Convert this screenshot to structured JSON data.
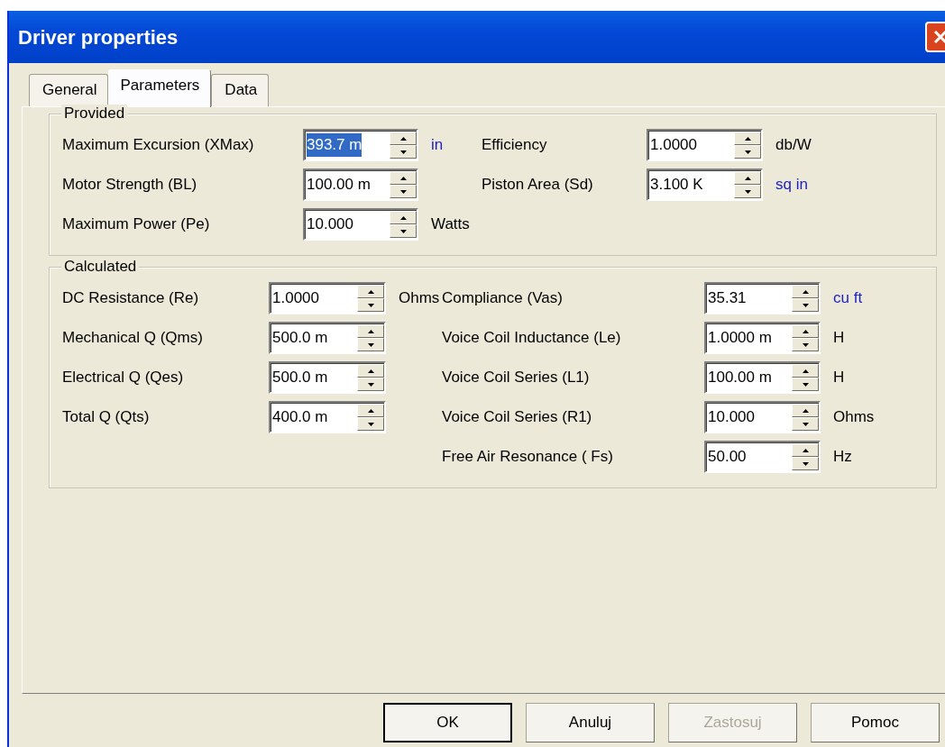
{
  "window": {
    "title": "Driver properties"
  },
  "tabs": [
    {
      "label": "General",
      "selected": false
    },
    {
      "label": "Parameters",
      "selected": true
    },
    {
      "label": "Data",
      "selected": false
    }
  ],
  "groups": [
    {
      "title": "Provided",
      "columns": [
        [
          {
            "label": "Maximum Excursion (XMax)",
            "value": "393.7 m",
            "text_selected": true,
            "unit": "in",
            "unit_link": true
          },
          {
            "label": "Motor Strength (BL)",
            "value": "100.00 m",
            "text_selected": false
          },
          {
            "label": "Maximum Power (Pe)",
            "value": "10.000",
            "text_selected": false,
            "unit": "Watts",
            "unit_link": false
          }
        ],
        [
          {
            "label": "Efficiency",
            "value": "1.0000",
            "text_selected": false,
            "unit": "db/W",
            "unit_link": false
          },
          {
            "label": "Piston Area (Sd)",
            "value": "3.100 K",
            "text_selected": false,
            "unit": "sq in",
            "unit_link": true
          }
        ]
      ]
    },
    {
      "title": "Calculated",
      "columns": [
        [
          {
            "label": "DC Resistance (Re)",
            "value": "1.0000",
            "text_selected": false,
            "unit": "Ohms",
            "unit_link": false
          },
          {
            "label": "Mechanical Q (Qms)",
            "value": "500.0 m",
            "text_selected": false
          },
          {
            "label": "Electrical Q (Qes)",
            "value": "500.0 m",
            "text_selected": false
          },
          {
            "label": "Total Q (Qts)",
            "value": "400.0 m",
            "text_selected": false
          }
        ],
        [
          {
            "label": "Compliance (Vas)",
            "value": "35.31",
            "text_selected": false,
            "unit": "cu ft",
            "unit_link": true
          },
          {
            "label": "Voice Coil Inductance (Le)",
            "value": "1.0000 m",
            "text_selected": false,
            "unit": "H",
            "unit_link": false
          },
          {
            "label": "Voice Coil Series (L1)",
            "value": "100.00 m",
            "text_selected": false,
            "unit": "H",
            "unit_link": false
          },
          {
            "label": "Voice Coil Series (R1)",
            "value": "10.000",
            "text_selected": false,
            "unit": "Ohms",
            "unit_link": false
          },
          {
            "label": "Free Air Resonance ( Fs)",
            "value": "50.00",
            "text_selected": false,
            "unit": "Hz",
            "unit_link": false
          }
        ]
      ]
    }
  ],
  "buttons": [
    {
      "label": "OK",
      "default": true,
      "disabled": false
    },
    {
      "label": "Anuluj",
      "default": false,
      "disabled": false
    },
    {
      "label": "Zastosuj",
      "default": false,
      "disabled": true
    },
    {
      "label": "Pomoc",
      "default": false,
      "disabled": false
    }
  ]
}
